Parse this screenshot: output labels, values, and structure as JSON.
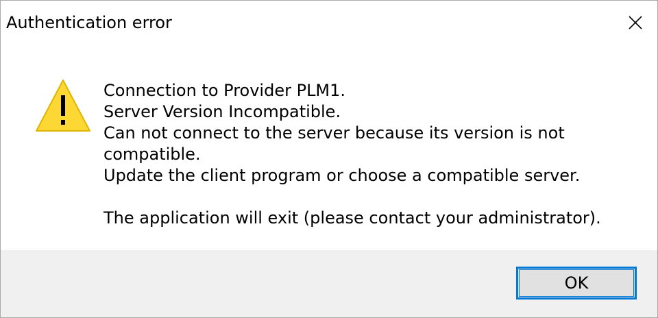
{
  "dialog": {
    "title": "Authentication error",
    "close_icon": "close-icon",
    "icon": "warning-icon",
    "message_lines": [
      "Connection to Provider PLM1.",
      "Server Version Incompatible.",
      "Can not connect to the server because its version is not",
      "compatible.",
      "Update the client program or choose a compatible server.",
      "",
      "The application will exit (please contact your administrator)."
    ],
    "ok_label": "OK"
  },
  "colors": {
    "accent": "#0078d7",
    "warning_fill": "#fdd835",
    "footer_bg": "#f0f0f0"
  }
}
